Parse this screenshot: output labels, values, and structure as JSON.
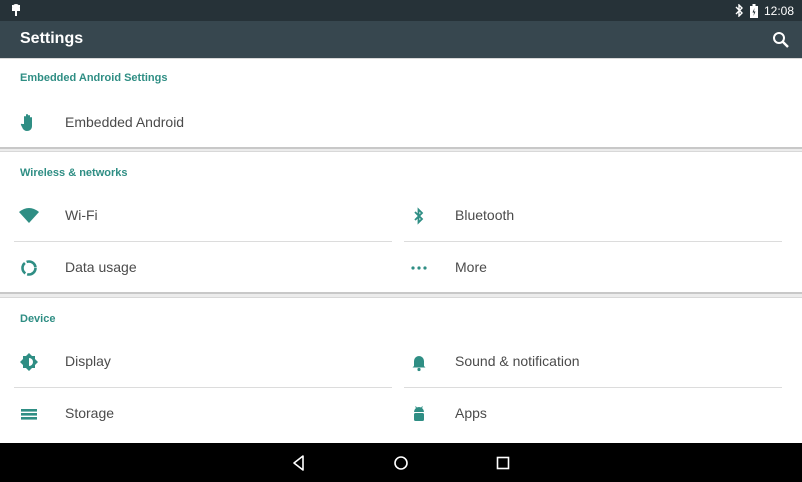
{
  "status_bar": {
    "time": "12:08"
  },
  "app_bar": {
    "title": "Settings"
  },
  "sections": [
    {
      "title": "Embedded Android Settings",
      "items": [
        {
          "label": "Embedded Android",
          "icon": "hand-icon"
        }
      ]
    },
    {
      "title": "Wireless & networks",
      "items": [
        {
          "label": "Wi-Fi",
          "icon": "wifi-icon"
        },
        {
          "label": "Bluetooth",
          "icon": "bluetooth-icon"
        },
        {
          "label": "Data usage",
          "icon": "data-usage-icon"
        },
        {
          "label": "More",
          "icon": "more-dots-icon"
        }
      ]
    },
    {
      "title": "Device",
      "items": [
        {
          "label": "Display",
          "icon": "brightness-icon"
        },
        {
          "label": "Sound & notification",
          "icon": "bell-icon"
        },
        {
          "label": "Storage",
          "icon": "storage-icon"
        },
        {
          "label": "Apps",
          "icon": "android-icon"
        }
      ]
    }
  ],
  "colors": {
    "accent": "#2f8e84",
    "status_bar": "#263238",
    "app_bar": "#37474f",
    "nav_bar": "#000000"
  }
}
